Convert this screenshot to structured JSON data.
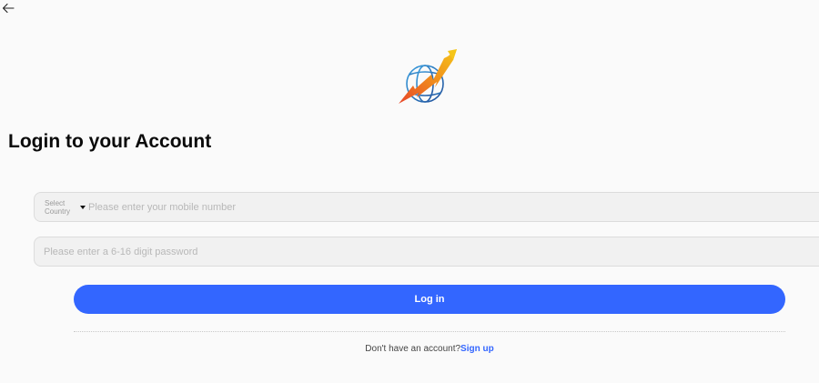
{
  "header": {
    "back_icon": "arrow-left-icon"
  },
  "logo": {
    "icon": "globe-arrow-logo",
    "colors": {
      "globe": "#2a7fd0",
      "arrow_top": "#f5c518",
      "arrow_bottom": "#e8462a"
    }
  },
  "title": "Login to your Account",
  "phone_field": {
    "country_label": "Select Country",
    "placeholder": "Please enter your mobile number"
  },
  "password_field": {
    "placeholder": "Please enter a 6-16 digit password"
  },
  "login_button": {
    "label": "Log in",
    "color": "#3366ff"
  },
  "signup": {
    "prompt": "Don't have an account?",
    "link": "Sign up"
  }
}
